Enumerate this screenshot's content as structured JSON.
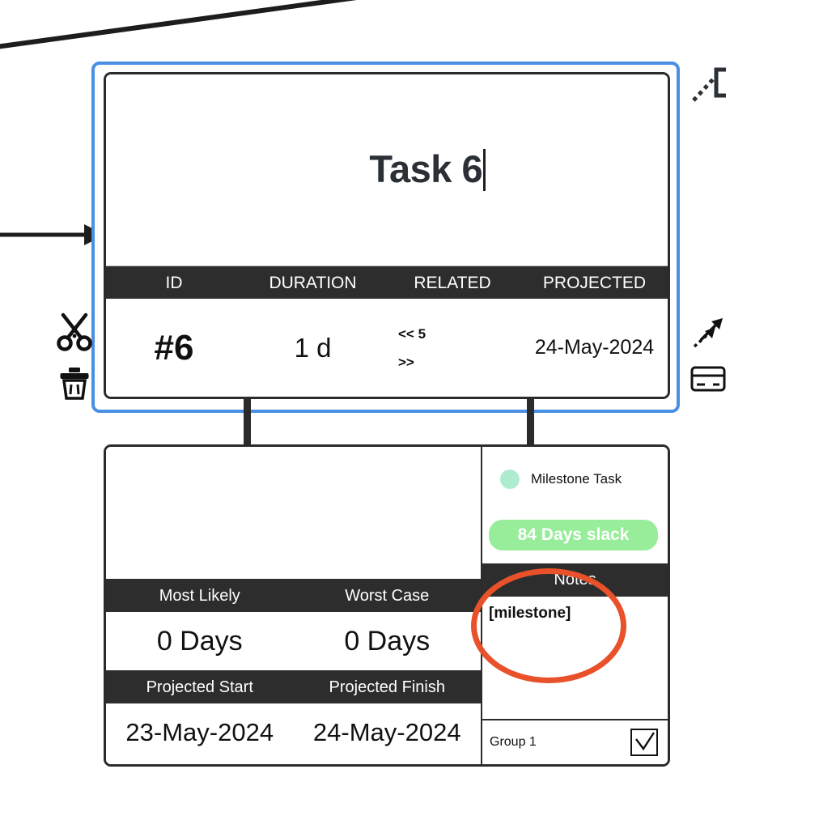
{
  "task_card": {
    "title": "Task 6",
    "editing": true,
    "selected": true,
    "columns": [
      "ID",
      "DURATION",
      "RELATED",
      "PROJECTED"
    ],
    "values": {
      "id": "#6",
      "duration": "1 d",
      "related_predecessors": "<< 5",
      "related_successors": ">>",
      "projected": "24-May-2024"
    }
  },
  "detail_card": {
    "estimate_headers": [
      "Most Likely",
      "Worst Case"
    ],
    "estimate_values": [
      "0 Days",
      "0 Days"
    ],
    "schedule_headers": [
      "Projected Start",
      "Projected Finish"
    ],
    "schedule_values": [
      "23-May-2024",
      "24-May-2024"
    ],
    "legend": {
      "label": "Milestone Task",
      "dot_color": "#aeeccf"
    },
    "slack_badge": {
      "label": "84 Days slack",
      "background": "#98ed9a",
      "text_color": "#ffffff"
    },
    "notes_header": "Notes",
    "notes_body": "[milestone]",
    "group": {
      "label": "Group 1",
      "checked": true,
      "check_glyph": "✓"
    }
  },
  "tools": {
    "cut": "cut-icon",
    "delete": "trash-icon",
    "link": "dependency-arrows-icon",
    "card": "card-icon",
    "dependency_start": "dependency-bracket-icon"
  },
  "colors": {
    "selection_border": "#4a90e2",
    "card_border": "#2b2b2b",
    "header_bar": "#2d2d2d",
    "annotation": "#e8512a"
  }
}
